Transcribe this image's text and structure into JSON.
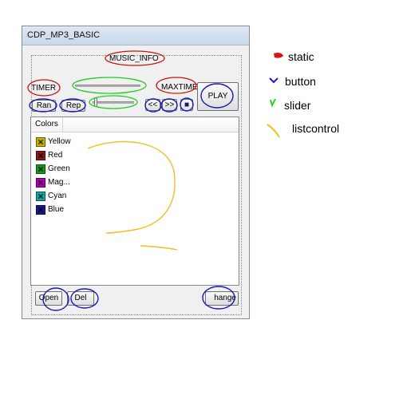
{
  "window": {
    "title": "CDP_MP3_BASIC"
  },
  "statics": {
    "music_info": "MUSIC_INFO",
    "timer": "TIMER",
    "maxtime": "MAXTIME"
  },
  "buttons": {
    "play": "PLAY",
    "random": "Ran",
    "repeat": "Rep",
    "prev": "<<",
    "next": ">>",
    "stop": "■",
    "open": "Open",
    "delete": "Del",
    "change": "hange"
  },
  "list": {
    "column": "Colors",
    "items": [
      {
        "label": "Yellow",
        "color": "#c8b400"
      },
      {
        "label": "Red",
        "color": "#8b1a1a"
      },
      {
        "label": "Green",
        "color": "#1a9a1a"
      },
      {
        "label": "Mag...",
        "color": "#b400b4"
      },
      {
        "label": "Cyan",
        "color": "#14a8a8"
      },
      {
        "label": "Blue",
        "color": "#1a1a8c"
      }
    ]
  },
  "legend": {
    "static": "static",
    "button": "button",
    "slider": "slider",
    "listcontrol": "listcontrol"
  },
  "annotation_colors": {
    "static": "#cc1111",
    "button": "#1a1ab8",
    "slider": "#22cc22",
    "listcontrol": "#f0c020"
  }
}
